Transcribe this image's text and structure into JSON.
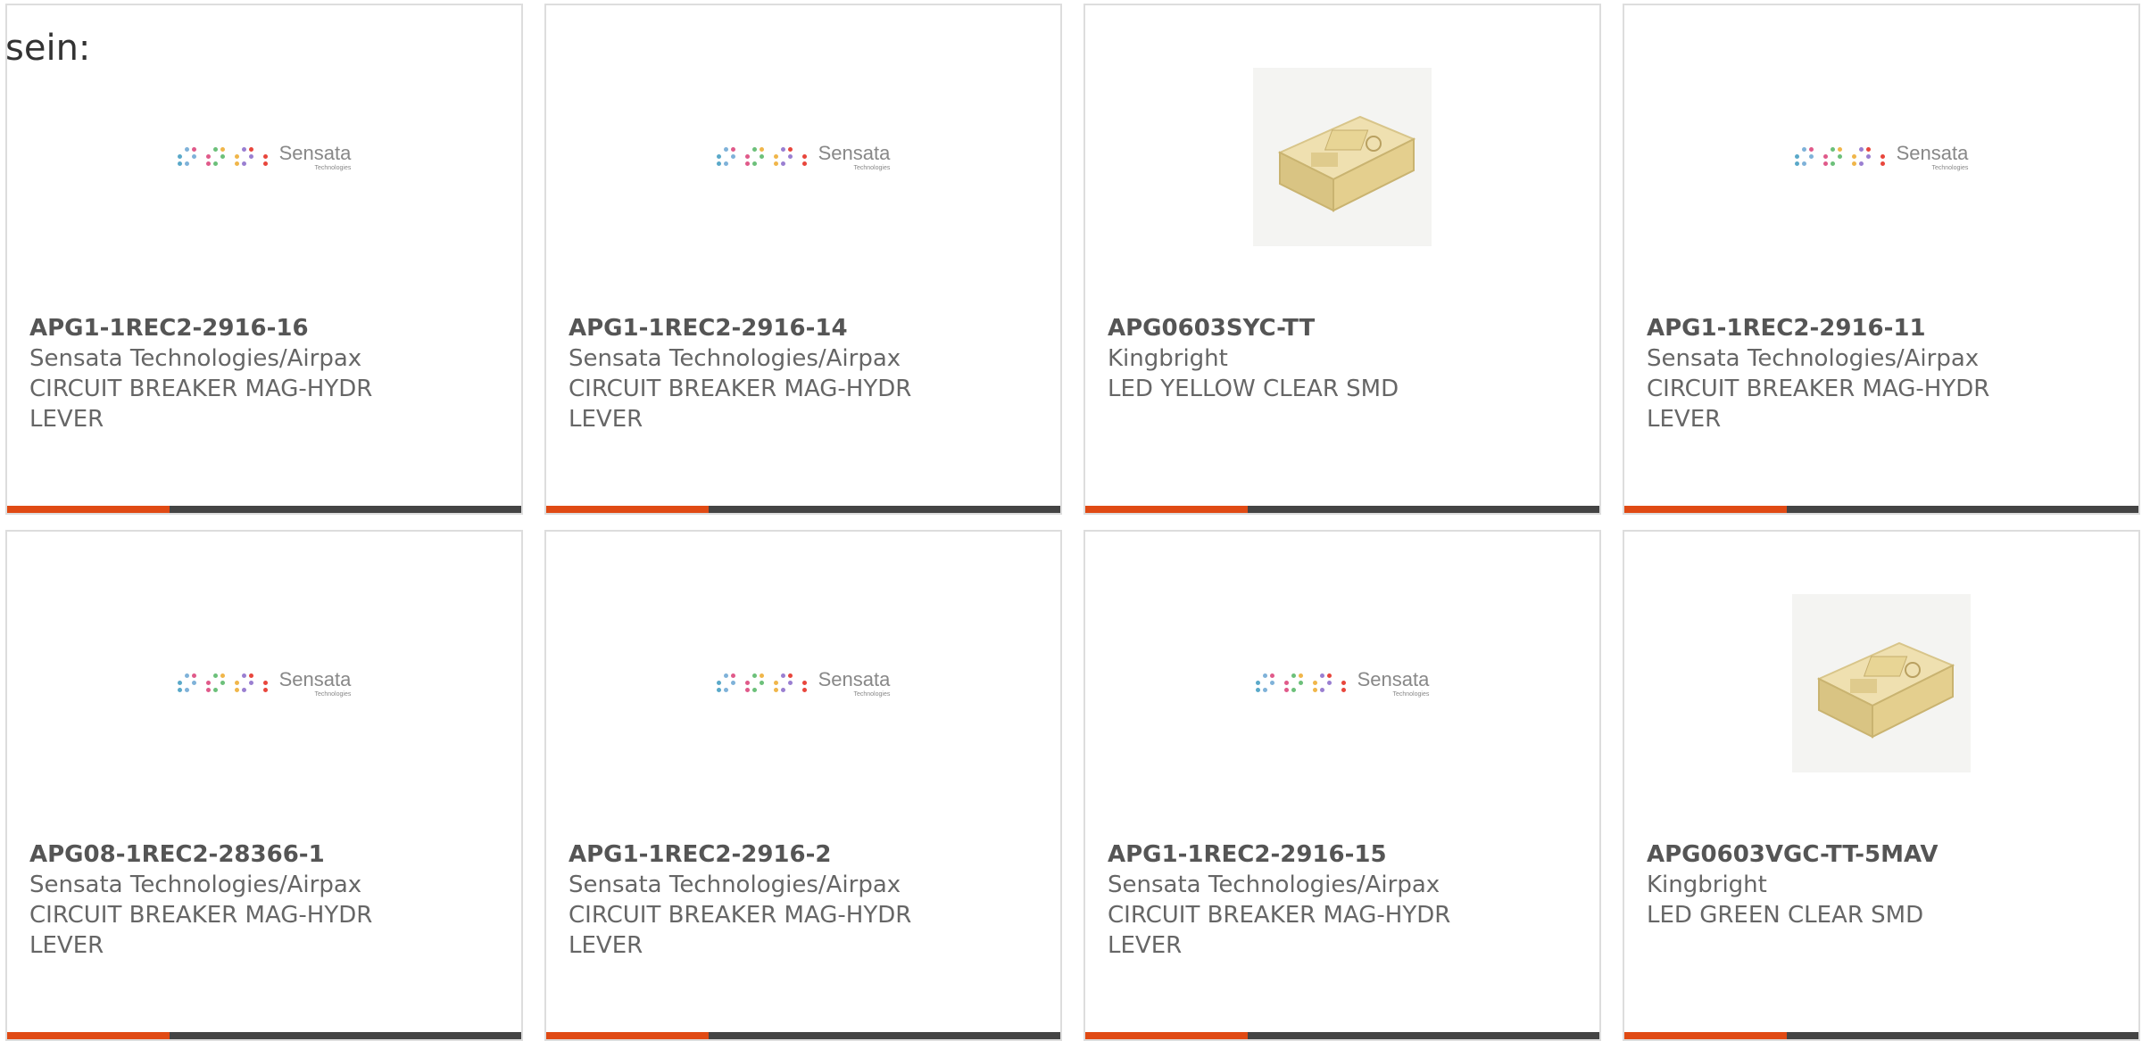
{
  "intro_text": "sein:",
  "colors": {
    "accent": "#e04a14",
    "bar": "#444444",
    "text": "#666666",
    "border": "#dddddd"
  },
  "logo": {
    "brand": "Sensata",
    "tagline": "Technologies"
  },
  "cards": [
    {
      "part_number": "APG1-1REC2-2916-16",
      "manufacturer": "Sensata Technologies/Airpax",
      "description_line1": "CIRCUIT BREAKER MAG-HYDR",
      "description_line2": "LEVER",
      "image": "sensata-logo"
    },
    {
      "part_number": "APG1-1REC2-2916-14",
      "manufacturer": "Sensata Technologies/Airpax",
      "description_line1": "CIRCUIT BREAKER MAG-HYDR",
      "description_line2": "LEVER",
      "image": "sensata-logo"
    },
    {
      "part_number": "APG0603SYC-TT",
      "manufacturer": "Kingbright",
      "description_line1": "LED YELLOW CLEAR SMD",
      "description_line2": "",
      "image": "led-package"
    },
    {
      "part_number": "APG1-1REC2-2916-11",
      "manufacturer": "Sensata Technologies/Airpax",
      "description_line1": "CIRCUIT BREAKER MAG-HYDR",
      "description_line2": "LEVER",
      "image": "sensata-logo"
    },
    {
      "part_number": "APG08-1REC2-28366-1",
      "manufacturer": "Sensata Technologies/Airpax",
      "description_line1": "CIRCUIT BREAKER MAG-HYDR",
      "description_line2": "LEVER",
      "image": "sensata-logo"
    },
    {
      "part_number": "APG1-1REC2-2916-2",
      "manufacturer": "Sensata Technologies/Airpax",
      "description_line1": "CIRCUIT BREAKER MAG-HYDR",
      "description_line2": "LEVER",
      "image": "sensata-logo"
    },
    {
      "part_number": "APG1-1REC2-2916-15",
      "manufacturer": "Sensata Technologies/Airpax",
      "description_line1": "CIRCUIT BREAKER MAG-HYDR",
      "description_line2": "LEVER",
      "image": "sensata-logo"
    },
    {
      "part_number": "APG0603VGC-TT-5MAV",
      "manufacturer": "Kingbright",
      "description_line1": "LED GREEN CLEAR SMD",
      "description_line2": "",
      "image": "led-package"
    }
  ]
}
